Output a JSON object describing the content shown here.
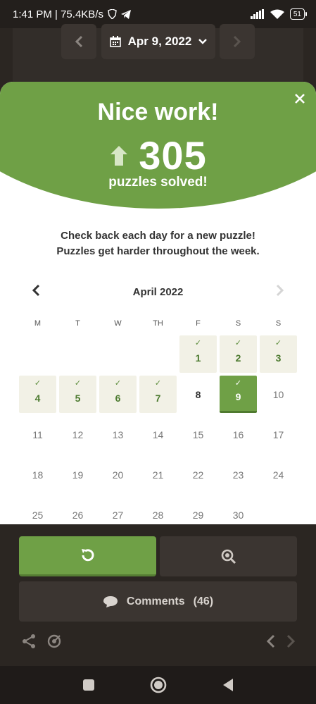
{
  "status_bar": {
    "time_speed": "1:41 PM | 75.4KB/s",
    "battery": "51"
  },
  "date_picker": {
    "label": "Apr 9, 2022"
  },
  "modal": {
    "title": "Nice work!",
    "count": "305",
    "subtitle": "puzzles solved!",
    "message_line1": "Check back each day for a new puzzle!",
    "message_line2": "Puzzles get harder throughout the week."
  },
  "calendar": {
    "month": "April 2022",
    "weekdays": [
      "M",
      "T",
      "W",
      "TH",
      "F",
      "S",
      "S"
    ],
    "days": [
      {
        "label": "",
        "state": "empty"
      },
      {
        "label": "",
        "state": "empty"
      },
      {
        "label": "",
        "state": "empty"
      },
      {
        "label": "",
        "state": "empty"
      },
      {
        "label": "1",
        "state": "solved"
      },
      {
        "label": "2",
        "state": "solved"
      },
      {
        "label": "3",
        "state": "solved"
      },
      {
        "label": "4",
        "state": "solved"
      },
      {
        "label": "5",
        "state": "solved"
      },
      {
        "label": "6",
        "state": "solved"
      },
      {
        "label": "7",
        "state": "solved"
      },
      {
        "label": "8",
        "state": "available"
      },
      {
        "label": "9",
        "state": "today"
      },
      {
        "label": "10",
        "state": "future"
      },
      {
        "label": "11",
        "state": "future"
      },
      {
        "label": "12",
        "state": "future"
      },
      {
        "label": "13",
        "state": "future"
      },
      {
        "label": "14",
        "state": "future"
      },
      {
        "label": "15",
        "state": "future"
      },
      {
        "label": "16",
        "state": "future"
      },
      {
        "label": "17",
        "state": "future"
      },
      {
        "label": "18",
        "state": "future"
      },
      {
        "label": "19",
        "state": "future"
      },
      {
        "label": "20",
        "state": "future"
      },
      {
        "label": "21",
        "state": "future"
      },
      {
        "label": "22",
        "state": "future"
      },
      {
        "label": "23",
        "state": "future"
      },
      {
        "label": "24",
        "state": "future"
      },
      {
        "label": "25",
        "state": "future"
      },
      {
        "label": "26",
        "state": "future"
      },
      {
        "label": "27",
        "state": "future"
      },
      {
        "label": "28",
        "state": "future"
      },
      {
        "label": "29",
        "state": "future"
      },
      {
        "label": "30",
        "state": "future"
      }
    ]
  },
  "actions": {
    "comments_label": "Comments",
    "comments_count": "(46)"
  },
  "colors": {
    "accent_green": "#6fa046",
    "dark_bg": "#2b2622",
    "button_dark": "#3b3531"
  }
}
